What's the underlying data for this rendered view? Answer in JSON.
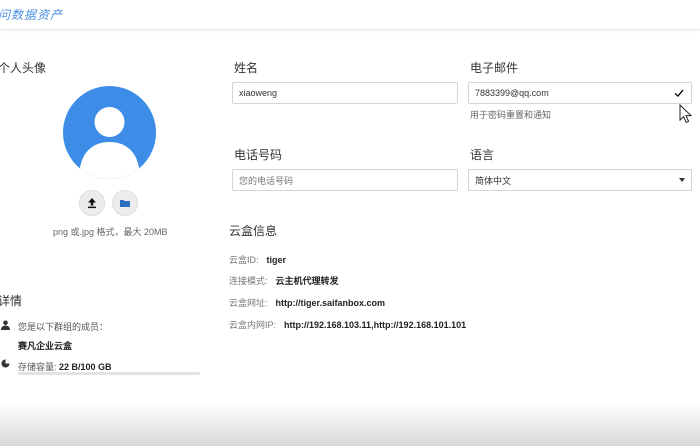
{
  "header": {
    "title": "问数据资产"
  },
  "avatar_section": {
    "title": "个人头像",
    "upload_hint": "png 或.jpg 格式，最大 20MB",
    "upload_icon": "upload-icon",
    "folder_icon": "folder-icon"
  },
  "details": {
    "title": "详情",
    "member_label": "您是以下群组的成员：",
    "group_name": "赛凡企业云盒",
    "storage_label": "存储容量:",
    "storage_value": "22 B/100 GB",
    "storage_fraction": 0.0
  },
  "form": {
    "name_label": "姓名",
    "name_value": "xiaoweng",
    "email_label": "电子邮件",
    "email_value": "7883399@qq.com",
    "email_note": "用于密码重置和通知",
    "phone_label": "电话号码",
    "phone_placeholder": "您的电话号码",
    "language_label": "语言",
    "language_value": "简体中文"
  },
  "cloud": {
    "title": "云盒信息",
    "rows": [
      {
        "label": "云盒ID:",
        "value": "tiger"
      },
      {
        "label": "连接模式:",
        "value": "云主机代理转发"
      },
      {
        "label": "云盒网址:",
        "value": "http://tiger.saifanbox.com"
      },
      {
        "label": "云盒内网IP:",
        "value": "http://192.168.103.11,http://192.168.101.101"
      }
    ]
  },
  "colors": {
    "accent": "#3d8de8",
    "text": "#333333",
    "muted": "#777777"
  }
}
